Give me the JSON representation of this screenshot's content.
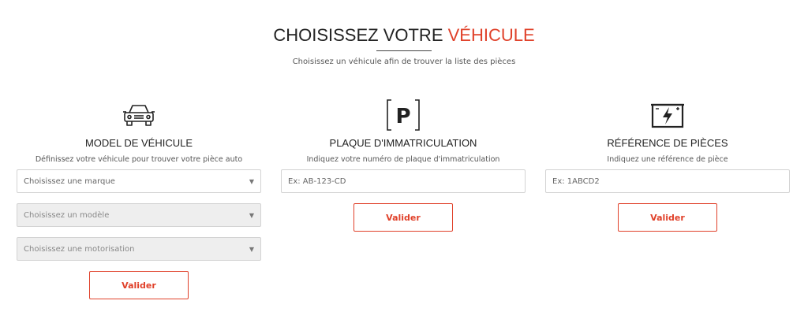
{
  "header": {
    "title_main": "CHOISISSEZ VOTRE ",
    "title_accent": "VÉHICULE",
    "subtitle": "Choisissez un véhicule afin de trouver la liste des pièces"
  },
  "colors": {
    "accent": "#e0412a",
    "disabled_bg": "#eeeeee",
    "border": "#d3d3d3"
  },
  "vehicle": {
    "icon": "car-icon",
    "title": "MODEL DE VÉHICULE",
    "description": "Définissez votre véhicule pour trouver votre pièce auto",
    "brand_placeholder": "Choisissez une marque",
    "model_placeholder": "Choisissez un modèle",
    "engine_placeholder": "Choisissez une motorisation",
    "submit_label": "Valider"
  },
  "plate": {
    "icon": "parking-plate-icon",
    "title": "PLAQUE D'IMMATRICULATION",
    "description": "Indiquez votre numéro de plaque d'immatriculation",
    "input_placeholder": "Ex: AB-123-CD",
    "submit_label": "Valider"
  },
  "reference": {
    "icon": "battery-icon",
    "title": "RÉFÉRENCE DE PIÈCES",
    "description": "Indiquez une référence de pièce",
    "input_placeholder": "Ex: 1ABCD2",
    "submit_label": "Valider"
  }
}
